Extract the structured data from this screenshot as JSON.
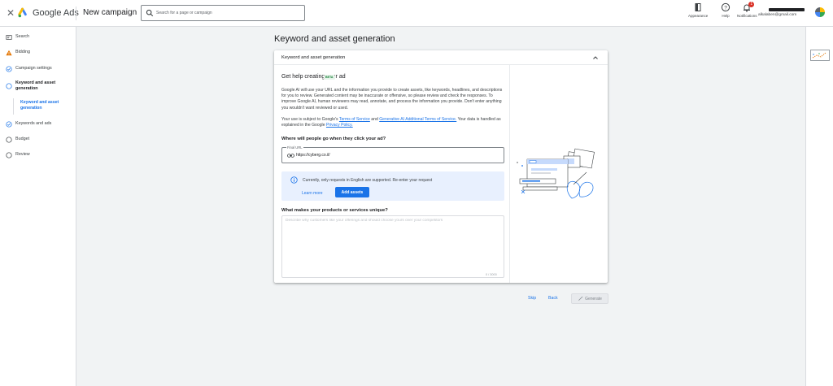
{
  "header": {
    "close_icon": "close-icon",
    "brand": "Google Ads",
    "campaign_title": "New campaign",
    "search_placeholder": "Search for a page or campaign",
    "appearance_label": "Appearance",
    "help_label": "Help",
    "notifications_label": "Notifications",
    "notifications_count": "1",
    "account_email": "alkalaben@gmail.com"
  },
  "sidebar": {
    "items": [
      {
        "label": "Search",
        "icon": "campaign-type-icon"
      },
      {
        "label": "Bidding",
        "icon": "warning-icon"
      },
      {
        "label": "Campaign settings",
        "icon": "check-circle-icon"
      },
      {
        "label": "Keyword and asset generation",
        "icon": "empty-circle-icon"
      },
      {
        "label": "Keywords and ads",
        "icon": "check-circle-icon"
      },
      {
        "label": "Budget",
        "icon": "empty-circle-icon"
      },
      {
        "label": "Review",
        "icon": "empty-circle-icon"
      }
    ],
    "subitem": "Keyword and asset generation"
  },
  "main": {
    "heading": "Keyword and asset generation",
    "card_title": "Keyword and asset generation",
    "help_title": "Get help creating your ad",
    "beta_label": "BETA",
    "paragraph1": "Google AI will use your URL and the information you provide to create assets, like keywords, headlines, and descriptions for you to review. Generated content may be inaccurate or offensive, so please review and check the responses. To improve Google AI, human reviewers may read, annotate, and process the information you provide. Don't enter anything you wouldn't want reviewed or used.",
    "paragraph2_prefix": "Your use is subject to Google's ",
    "terms_link": "Terms of Service",
    "paragraph2_and": " and ",
    "gen_ai_terms_link": "Generative AI Additional Terms of Service.",
    "paragraph2_mid": " Your data is handled as explained in the Google ",
    "privacy_link": "Privacy Policy.",
    "url_question": "Where will people go when they click your ad?",
    "final_url_label": "Final URL",
    "final_url_value": "https://cyberg.co.il/",
    "info_text": "Currently, only requests in English are supported. Re-enter your request",
    "learn_more": "Learn more",
    "add_assets": "Add assets",
    "unique_question": "What makes your products or services unique?",
    "unique_placeholder": "Describe why customers like your offerings and should choose yours over your competitors",
    "char_counter": "0 / 3000"
  },
  "actions": {
    "skip": "Skip",
    "back": "Back",
    "generate": "Generate"
  },
  "colors": {
    "accent": "#1a73e8",
    "warning": "#e37400",
    "background": "#f1f3f4"
  }
}
